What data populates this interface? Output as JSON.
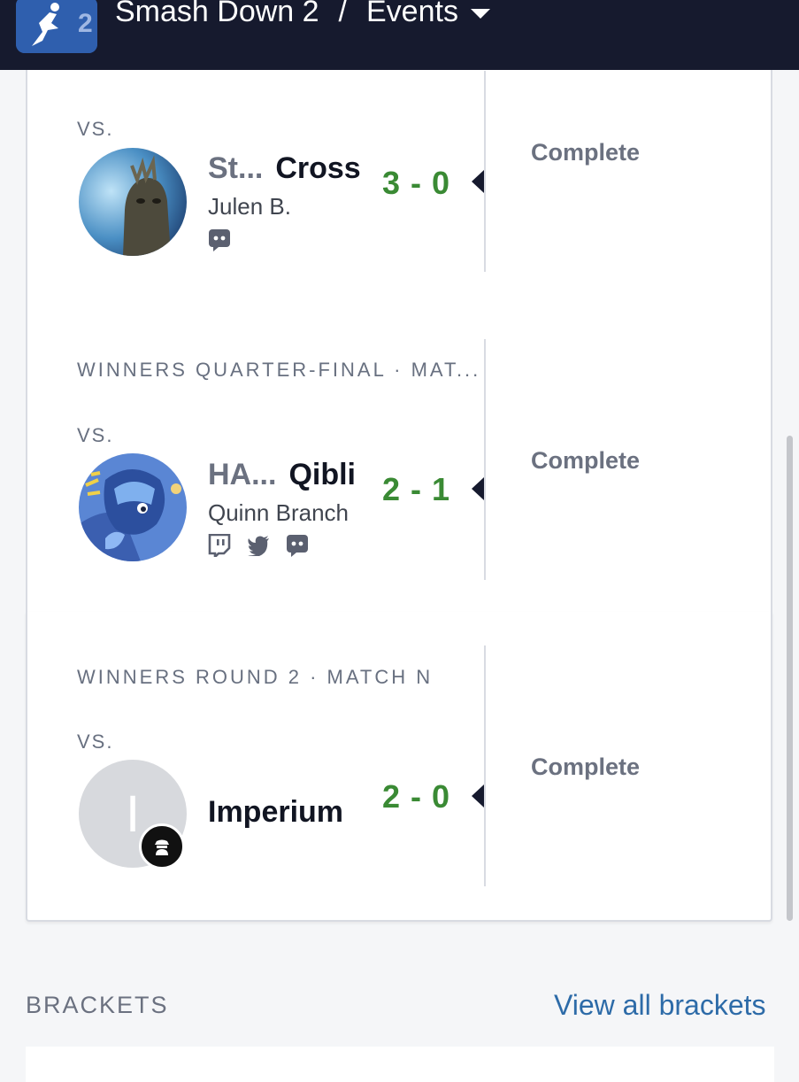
{
  "header": {
    "logo_alt": "Smash Down 2 logo",
    "title": "Smash Down 2",
    "separator": "/",
    "section": "Events"
  },
  "sets": [
    {
      "round": "",
      "vs": "VS.",
      "prefix": "St...",
      "tag": "Cross",
      "real_name": "Julen B.",
      "score": "3 - 0",
      "status": "Complete",
      "socials": [
        "discord-icon"
      ]
    },
    {
      "round": "WINNERS QUARTER-FINAL · MAT...",
      "vs": "VS.",
      "prefix": "HA...",
      "tag": "Qibli",
      "real_name": "Quinn Branch",
      "score": "2 - 1",
      "status": "Complete",
      "socials": [
        "twitch-icon",
        "twitter-icon",
        "discord-icon"
      ]
    },
    {
      "round": "WINNERS ROUND 2 · MATCH N",
      "vs": "VS.",
      "prefix": "",
      "tag": "Imperium",
      "real_name": "",
      "avatar_initial": "I",
      "score": "2 - 0",
      "status": "Complete",
      "socials": []
    }
  ],
  "brackets": {
    "title": "BRACKETS",
    "view_all": "View all brackets"
  },
  "colors": {
    "header_bg": "#161a2e",
    "score_green": "#3a8a34",
    "link_blue": "#2d6ba8"
  }
}
